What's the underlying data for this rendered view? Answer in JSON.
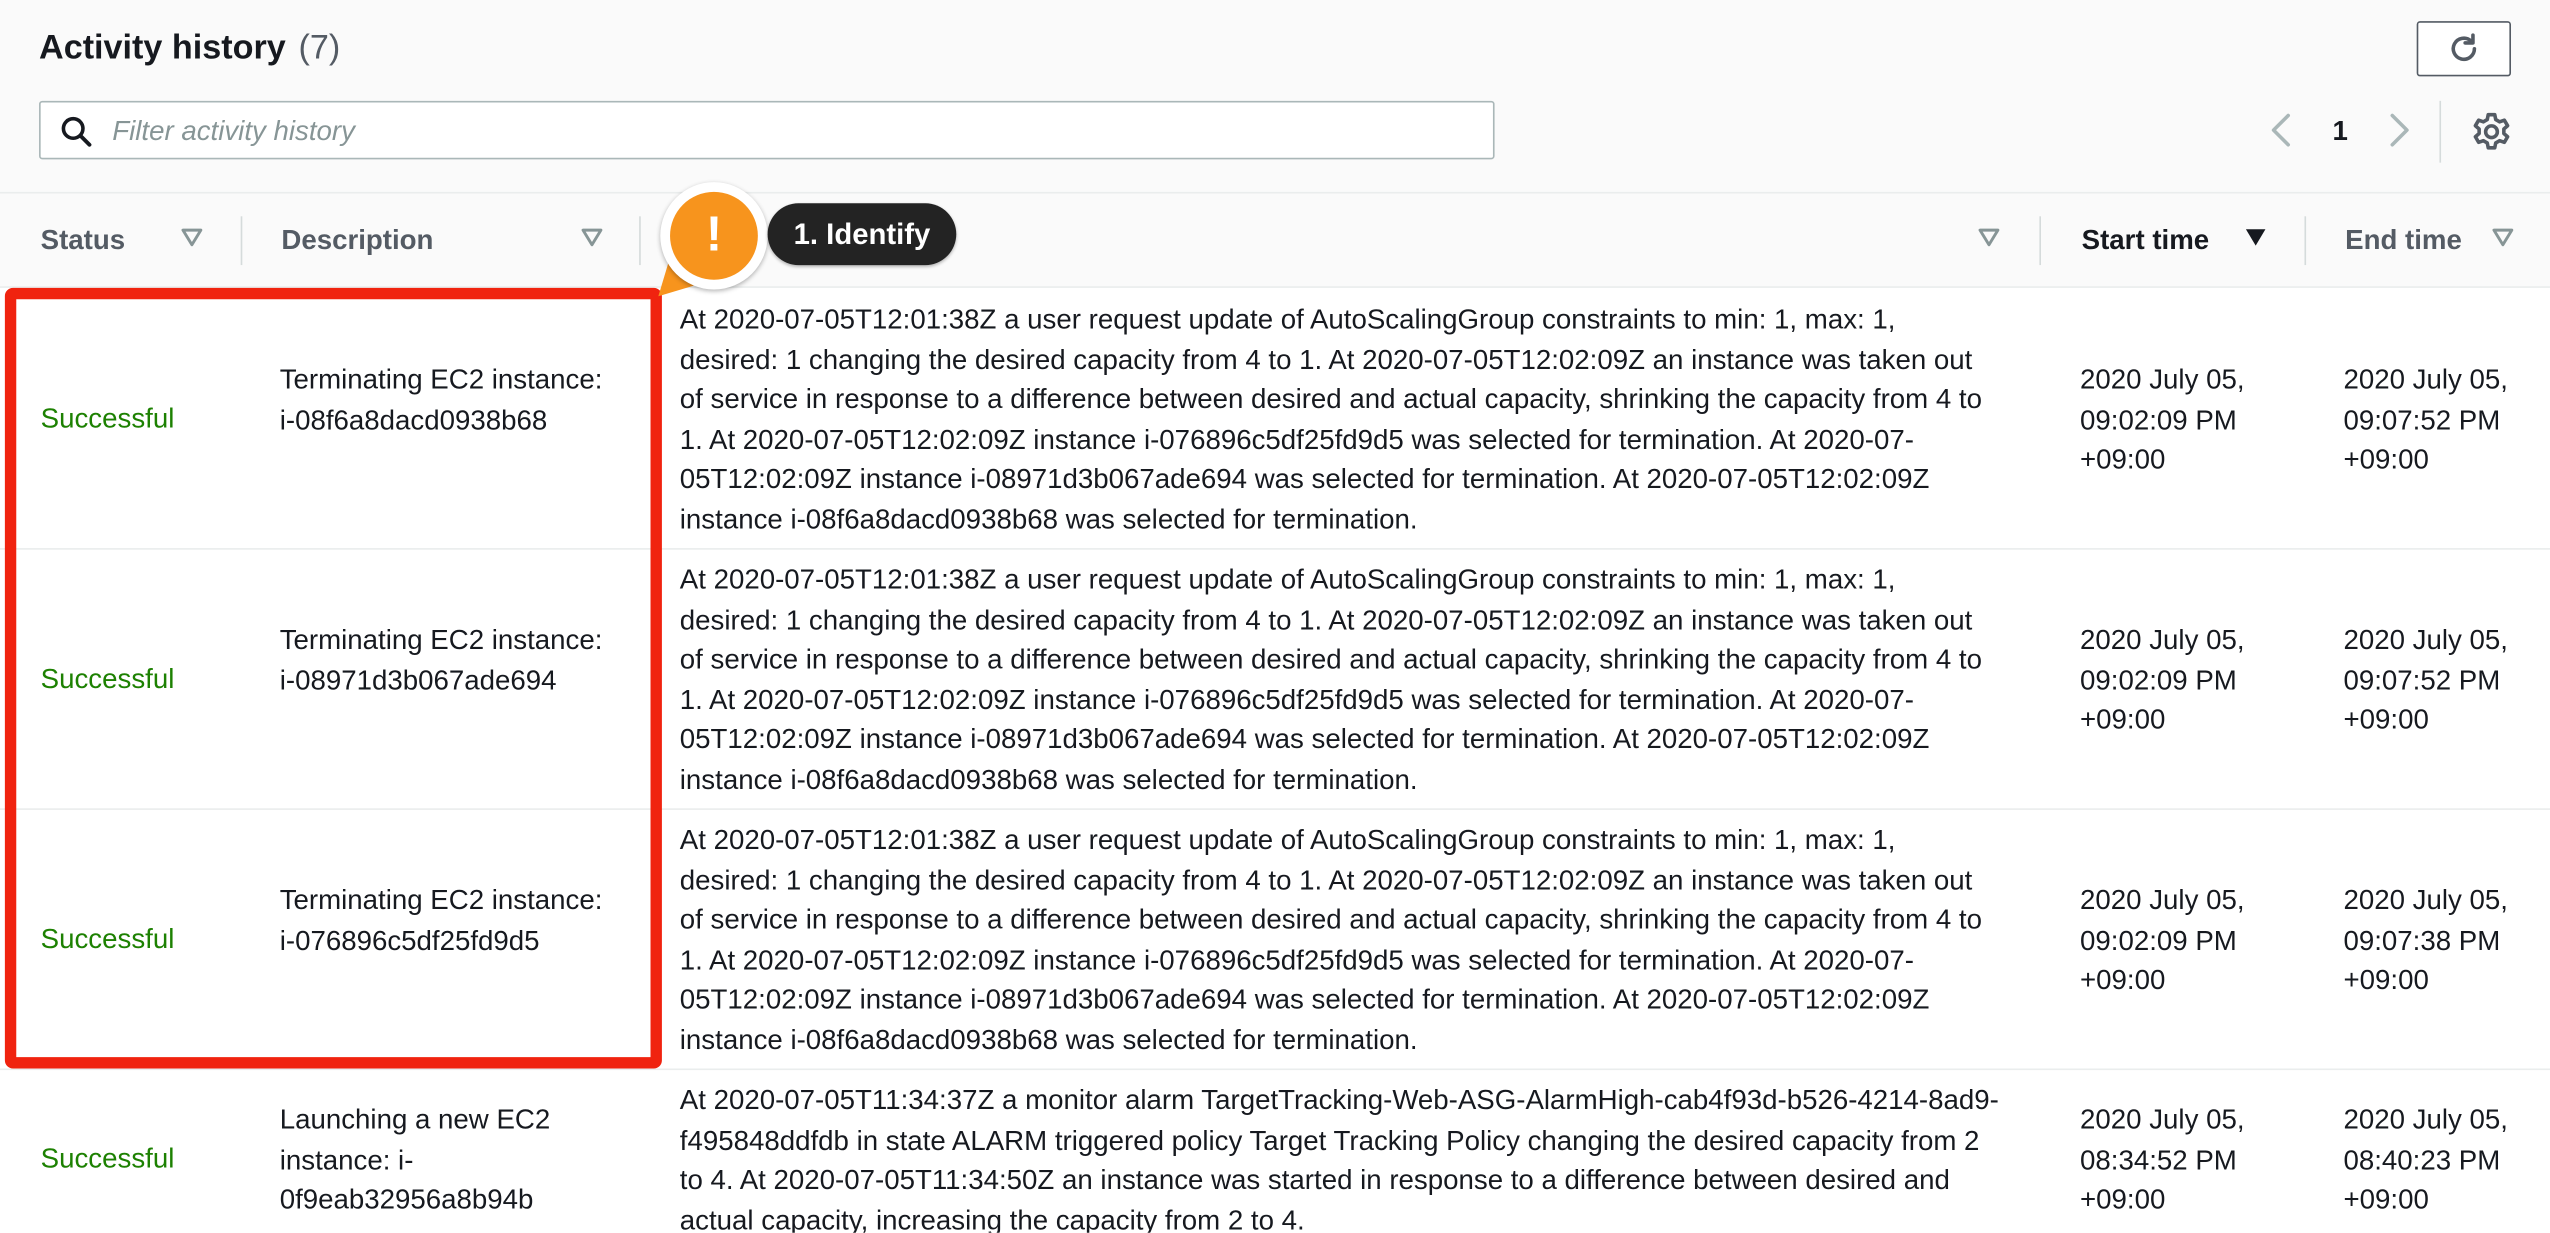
{
  "header": {
    "title": "Activity history",
    "count": "(7)"
  },
  "toolbar": {
    "refresh_icon": "refresh-icon"
  },
  "search": {
    "placeholder": "Filter activity history",
    "value": ""
  },
  "pagination": {
    "current_page": "1"
  },
  "columns": [
    "Status",
    "Description",
    "",
    "Start time",
    "End time"
  ],
  "annotation": {
    "label": "1. Identify",
    "badge": "!",
    "accent_color": "#f7941d",
    "highlight_color": "#f0230f"
  },
  "rows": [
    {
      "status": "Successful",
      "description": "Terminating EC2 instance: i-08f6a8dacd0938b68",
      "cause": "At 2020-07-05T12:01:38Z a user request update of AutoScalingGroup constraints to min: 1, max: 1, desired: 1 changing the desired capacity from 4 to 1. At 2020-07-05T12:02:09Z an instance was taken out of service in response to a difference between desired and actual capacity, shrinking the capacity from 4 to 1. At 2020-07-05T12:02:09Z instance i-076896c5df25fd9d5 was selected for termination. At 2020-07-05T12:02:09Z instance i-08971d3b067ade694 was selected for termination. At 2020-07-05T12:02:09Z instance i-08f6a8dacd0938b68 was selected for termination.",
      "start_time": "2020 July 05, 09:02:09 PM +09:00",
      "end_time": "2020 July 05, 09:07:52 PM +09:00"
    },
    {
      "status": "Successful",
      "description": "Terminating EC2 instance: i-08971d3b067ade694",
      "cause": "At 2020-07-05T12:01:38Z a user request update of AutoScalingGroup constraints to min: 1, max: 1, desired: 1 changing the desired capacity from 4 to 1. At 2020-07-05T12:02:09Z an instance was taken out of service in response to a difference between desired and actual capacity, shrinking the capacity from 4 to 1. At 2020-07-05T12:02:09Z instance i-076896c5df25fd9d5 was selected for termination. At 2020-07-05T12:02:09Z instance i-08971d3b067ade694 was selected for termination. At 2020-07-05T12:02:09Z instance i-08f6a8dacd0938b68 was selected for termination.",
      "start_time": "2020 July 05, 09:02:09 PM +09:00",
      "end_time": "2020 July 05, 09:07:52 PM +09:00"
    },
    {
      "status": "Successful",
      "description": "Terminating EC2 instance: i-076896c5df25fd9d5",
      "cause": "At 2020-07-05T12:01:38Z a user request update of AutoScalingGroup constraints to min: 1, max: 1, desired: 1 changing the desired capacity from 4 to 1. At 2020-07-05T12:02:09Z an instance was taken out of service in response to a difference between desired and actual capacity, shrinking the capacity from 4 to 1. At 2020-07-05T12:02:09Z instance i-076896c5df25fd9d5 was selected for termination. At 2020-07-05T12:02:09Z instance i-08971d3b067ade694 was selected for termination. At 2020-07-05T12:02:09Z instance i-08f6a8dacd0938b68 was selected for termination.",
      "start_time": "2020 July 05, 09:02:09 PM +09:00",
      "end_time": "2020 July 05, 09:07:38 PM +09:00"
    },
    {
      "status": "Successful",
      "description": "Launching a new EC2 instance: i-0f9eab32956a8b94b",
      "cause": "At 2020-07-05T11:34:37Z a monitor alarm TargetTracking-Web-ASG-AlarmHigh-cab4f93d-b526-4214-8ad9-f495848ddfdb in state ALARM triggered policy Target Tracking Policy changing the desired capacity from 2 to 4. At 2020-07-05T11:34:50Z an instance was started in response to a difference between desired and actual capacity, increasing the capacity from 2 to 4.",
      "start_time": "2020 July 05, 08:34:52 PM +09:00",
      "end_time": "2020 July 05, 08:40:23 PM +09:00"
    }
  ]
}
